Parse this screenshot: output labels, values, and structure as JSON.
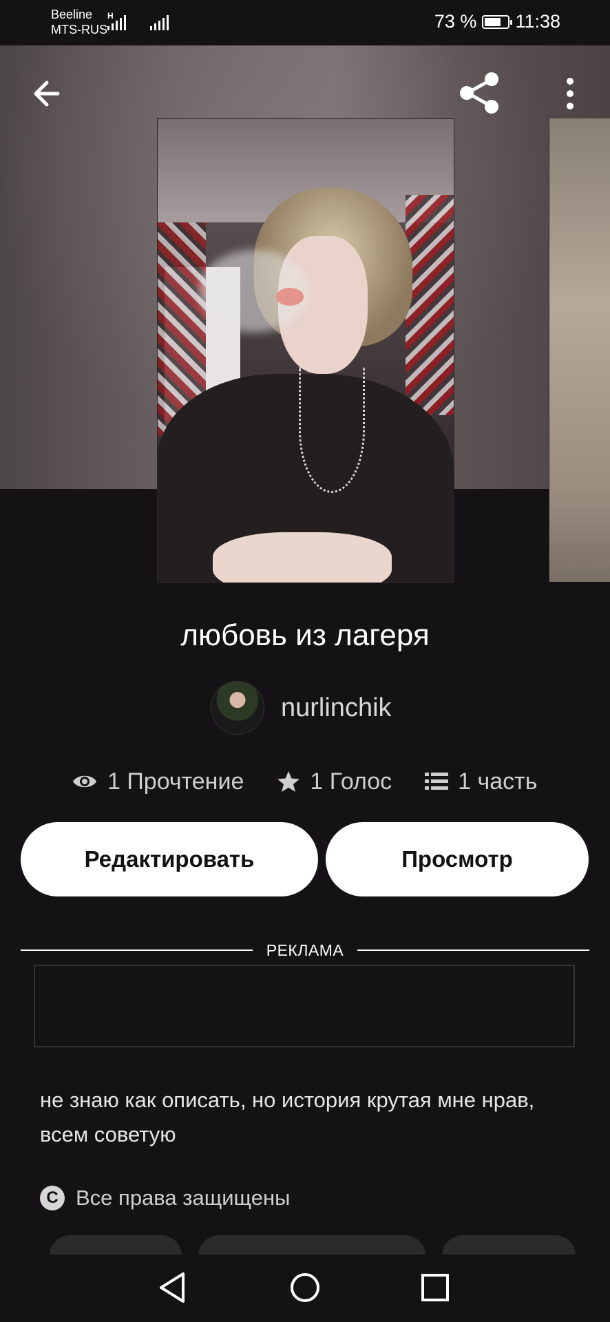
{
  "status_bar": {
    "carrier_1": "Beeline",
    "carrier_2": "MTS-RUS",
    "network_badge": "H",
    "battery_percent": "73 %",
    "battery_level": 0.73,
    "time": "11:38"
  },
  "header": {
    "back_icon": "arrow-left-icon",
    "share_icon": "share-icon",
    "more_icon": "more-vertical-icon"
  },
  "story": {
    "title": "любовь из лагеря",
    "author": "nurlinchik",
    "stats": {
      "reads": "1 Прочтение",
      "votes": "1 Голос",
      "parts": "1 часть"
    },
    "edit_label": "Редактировать",
    "view_label": "Просмотр",
    "ad_label": "РЕКЛАМА",
    "description": "не знаю как описать, но история крутая мне нрав, всем советую",
    "rights": "Все права защищены",
    "copyright_icon": "copyright-icon"
  },
  "navbar": {
    "back_icon": "nav-back-icon",
    "home_icon": "nav-home-icon",
    "recents_icon": "nav-recents-icon"
  },
  "colors": {
    "background": "#141215",
    "button_bg": "#ffffff",
    "button_text": "#111111",
    "muted_text": "#cfcfcf"
  }
}
